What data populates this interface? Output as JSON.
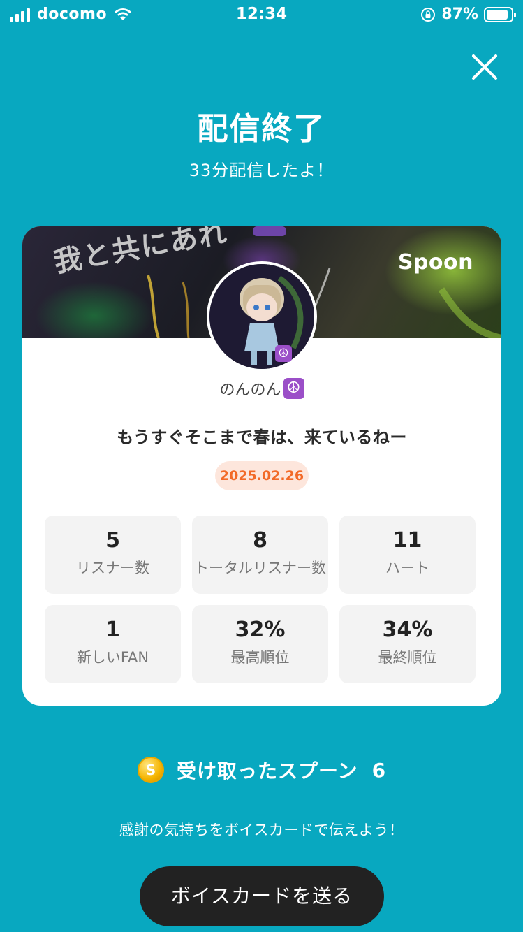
{
  "status_bar": {
    "carrier": "docomo",
    "time": "12:34",
    "battery_percent": "87%",
    "battery_level": 0.87,
    "icons": [
      "signal-icon",
      "wifi-icon",
      "rotation-lock-icon",
      "battery-icon"
    ]
  },
  "header": {
    "close_icon": "close-icon",
    "title": "配信終了",
    "subtitle": "33分配信したよ！"
  },
  "card": {
    "banner_text": "我と共にあれ",
    "brand": "Spoon",
    "username": "のんのん",
    "username_emoji": "☮",
    "avatar_badge": "☮",
    "live_title": "もうすぐそこまで春は、来ているねー",
    "date": "2025.02.26",
    "stats": [
      {
        "value": "5",
        "label": "リスナー数"
      },
      {
        "value": "8",
        "label": "トータルリスナー数"
      },
      {
        "value": "11",
        "label": "ハート"
      },
      {
        "value": "1",
        "label": "新しいFAN"
      },
      {
        "value": "32%",
        "label": "最高順位"
      },
      {
        "value": "34%",
        "label": "最終順位"
      }
    ]
  },
  "spoons": {
    "coin_symbol": "S",
    "label": "受け取ったスプーン",
    "count": "6"
  },
  "thanks_text": "感謝の気持ちをボイスカードで伝えよう！",
  "voice_card_button": "ボイスカードを送る",
  "colors": {
    "background": "#08a8c0",
    "date_accent": "#f26a28",
    "button": "#222222",
    "badge_purple": "#9b4fc8"
  }
}
